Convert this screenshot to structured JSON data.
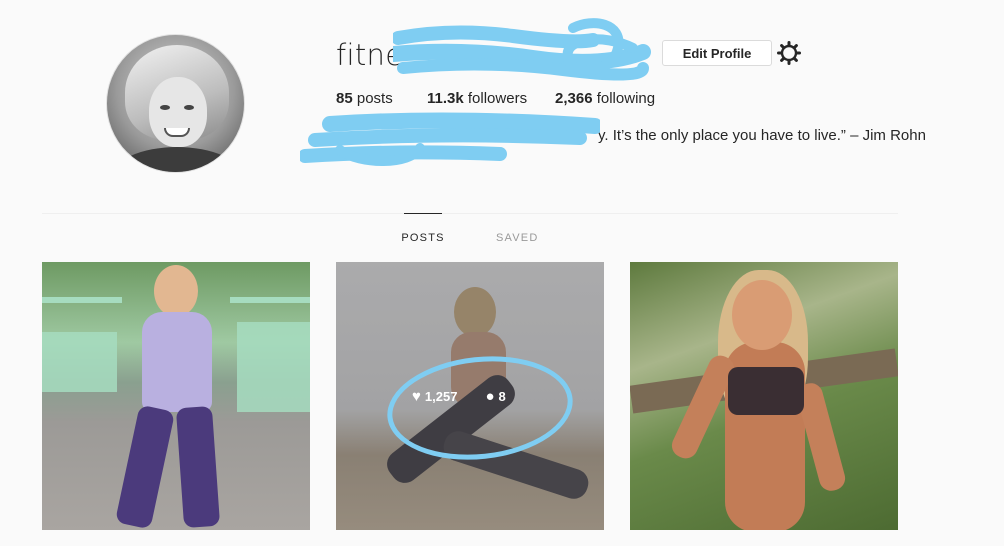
{
  "profile": {
    "username": "fitne",
    "edit_profile_label": "Edit Profile",
    "settings_icon": "gear-icon",
    "stats": [
      {
        "value": "85",
        "label": " posts"
      },
      {
        "value": "11.3k",
        "label": " followers"
      },
      {
        "value": "2,366",
        "label": " following"
      }
    ],
    "bio_visible": "y. It’s the only place you have to live.” – Jim Rohn"
  },
  "tabs": [
    {
      "label": "POSTS",
      "active": true
    },
    {
      "label": "SAVED",
      "active": false
    }
  ],
  "posts": [
    {
      "kind": "photo"
    },
    {
      "kind": "photo",
      "likes": "1,257",
      "comments": "8"
    },
    {
      "kind": "photo"
    }
  ],
  "colors": {
    "redaction": "#7fcdf2",
    "text": "#262626",
    "muted": "#999999",
    "background": "#fafafa"
  }
}
